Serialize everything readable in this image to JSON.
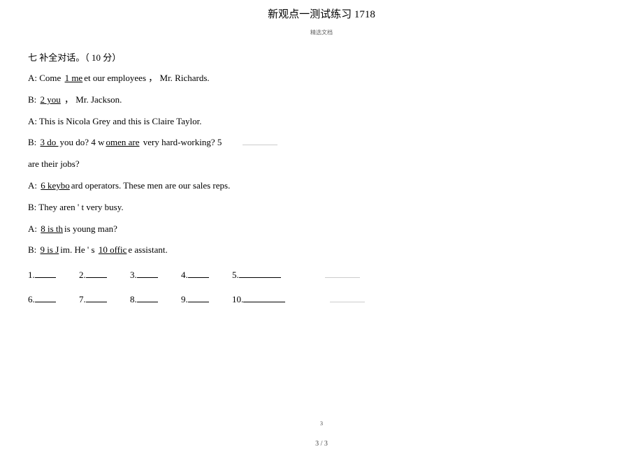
{
  "title": "新观点一测试练习 1718",
  "subtitle": "精选文档",
  "section_header": "七  补全对话。（ 10 分）",
  "lines": {
    "l1_pre": "A: Come ",
    "l1_blank": "  1    me",
    "l1_post": "et our employees          ，   Mr. Richards.",
    "l2_pre": "B: ",
    "l2_blank": "  2    you",
    "l2_post": "          ，   Mr. Jackson.",
    "l3": "A: This is Nicola Grey and this is Claire Taylor.",
    "l4_pre": "B: ",
    "l4_b1": "  3    do ",
    "l4_mid1": "you do?    4    w",
    "l4_b2": "omen are",
    "l4_post": " very hard-working?    5",
    "l5": "are their jobs?",
    "l6_pre": "A: ",
    "l6_blank": "  6   keybo",
    "l6_post": "ard operators. These men are our sales reps.",
    "l7": "B: They aren    ' t very busy.",
    "l8_pre": "A: ",
    "l8_blank": "  8   is th",
    "l8_post": "is young man?",
    "l9_pre": "B: ",
    "l9_b1": "  9    is J",
    "l9_mid": "im. He              ' s ",
    "l9_b2": "10     offic",
    "l9_post": "e assistant."
  },
  "answers_row1": [
    "1.",
    "2.",
    "3.",
    "4.",
    "5."
  ],
  "answers_row2": [
    "6.",
    "7.",
    "8.",
    "9.",
    "10."
  ],
  "footer_small": "3",
  "footer_page": "3 / 3"
}
